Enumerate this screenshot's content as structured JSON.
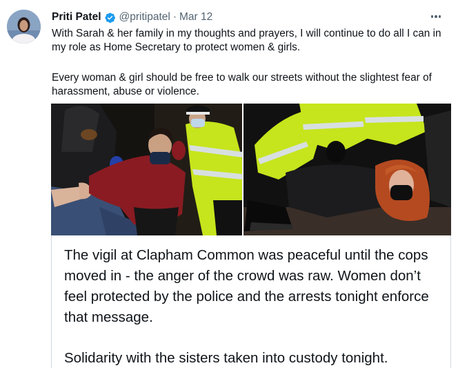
{
  "tweet": {
    "author_name": "Priti Patel",
    "handle": "@pritipatel",
    "separator": "·",
    "date": "Mar 12",
    "paragraph_1": "With Sarah & her family in my thoughts and prayers, I will continue to do all I can in my role as Home Secretary to protect women & girls.",
    "paragraph_2": "Every woman & girl should be free to walk our streets without the slightest fear of harassment, abuse or violence."
  },
  "icons": {
    "verified": "verified-badge-icon",
    "more": "more-options-icon"
  },
  "colors": {
    "verified_blue": "#1d9bf0",
    "secondary_text": "#536471",
    "primary_text": "#0f1419",
    "border": "#cfd9de",
    "hi_vis_yellow": "#c6e51c"
  },
  "quoted_text": {
    "paragraph_1": "The vigil at Clapham Common was peaceful until the cops moved in - the anger of the crowd was raw. Women don’t feel protected by the police and the arrests tonight enforce that message.",
    "paragraph_2": "Solidarity with the sisters taken into custody tonight."
  }
}
